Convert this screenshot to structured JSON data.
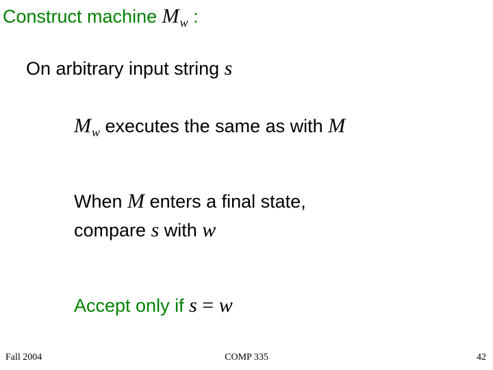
{
  "title": {
    "pre": "Construct machine ",
    "mw_M": "M",
    "mw_sub": "w",
    "post": " :"
  },
  "sub": {
    "pre": "On arbitrary input string ",
    "s": "s"
  },
  "exec": {
    "mw_M": "M",
    "mw_sub": "w",
    "mid": " executes the same as with ",
    "M": "M"
  },
  "when": {
    "pre": "When ",
    "M": "M",
    "post": " enters a final state,"
  },
  "compare": {
    "pre": "compare ",
    "s": "s",
    "mid": " with ",
    "w": "w"
  },
  "accept": {
    "pre": "Accept only if ",
    "eq_left": "s",
    "eq_op": " = ",
    "eq_right": "w"
  },
  "footer": {
    "left": "Fall 2004",
    "center": "COMP 335",
    "right": "42"
  }
}
